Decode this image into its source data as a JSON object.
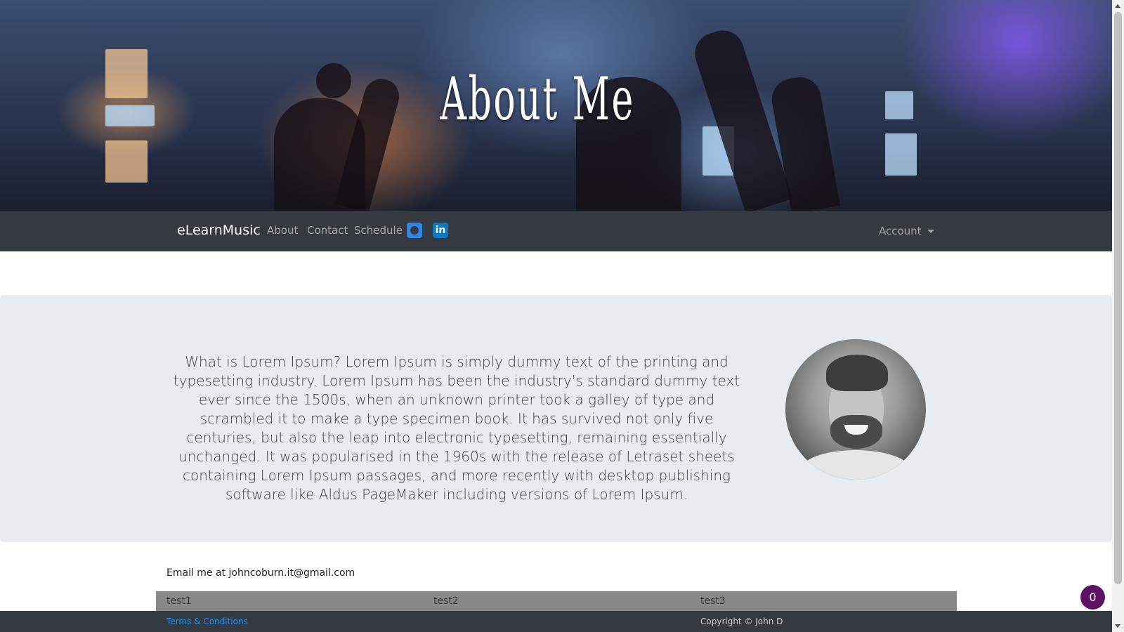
{
  "hero": {
    "title": "About Me"
  },
  "navbar": {
    "brand": "eLearnMusic",
    "links": [
      "About",
      "Contact",
      "Schedule"
    ],
    "icons": [
      "github-icon",
      "linkedin-icon"
    ],
    "linkedin_glyph": "in",
    "account_label": "Account"
  },
  "main": {
    "lead": "What is Lorem Ipsum? Lorem Ipsum is simply dummy text of the printing and typesetting industry. Lorem Ipsum has been the industry's standard dummy text ever since the 1500s, when an unknown printer took a galley of type and scrambled it to make a type specimen book. It has survived not only five centuries, but also the leap into electronic typesetting, remaining essentially unchanged. It was popularised in the 1960s with the release of Letraset sheets containing Lorem Ipsum passages, and more recently with desktop publishing software like Aldus PageMaker including versions of Lorem Ipsum.",
    "email_text": "Email me at johncoburn.it@gmail.com"
  },
  "tests": [
    "test1",
    "test2",
    "test3"
  ],
  "footer": {
    "terms": "Terms & Conditions",
    "copyright": "Copyright © John D"
  },
  "badge": {
    "count": "0"
  },
  "colors": {
    "navbar": "#343a40",
    "jumbotron": "#e9ecef",
    "badge": "#5e1167",
    "link": "#1e90ff"
  }
}
